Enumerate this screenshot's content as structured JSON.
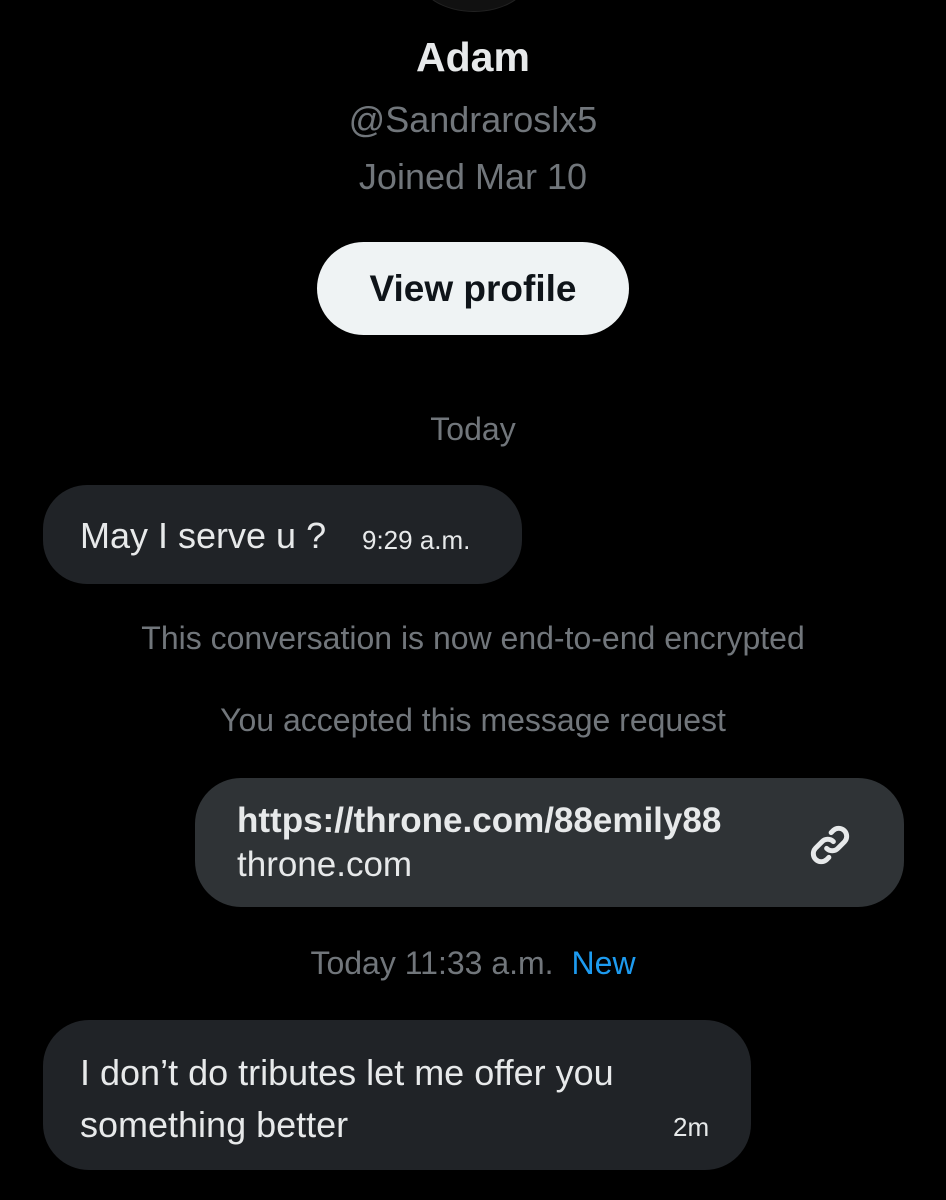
{
  "profile": {
    "name": "Adam",
    "handle": "@Sandraroslx5",
    "joined": "Joined Mar 10",
    "view_profile_label": "View profile"
  },
  "conversation": {
    "date_divider": "Today",
    "messages": [
      {
        "direction": "incoming",
        "text": "May I serve u ?",
        "time": "9:29 a.m."
      }
    ],
    "system_notes": [
      "This conversation is now end-to-end encrypted",
      "You accepted this message request"
    ],
    "link_card": {
      "url": "https://throne.com/88emily88",
      "domain": "throne.com",
      "icon": "link-icon"
    },
    "timestamp": {
      "text": "Today 11:33 a.m.",
      "badge": "New"
    },
    "latest_message": {
      "direction": "incoming",
      "text": "I don’t do tributes let me offer you something better",
      "time": "2m"
    }
  },
  "colors": {
    "background": "#000000",
    "text_primary": "#e7e9ea",
    "text_secondary": "#71767b",
    "accent": "#1d9bf0",
    "bubble_incoming": "#202327",
    "bubble_outgoing": "#2f3336"
  }
}
